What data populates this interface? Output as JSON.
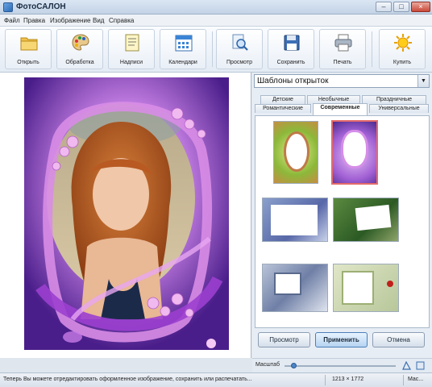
{
  "window": {
    "title": "ФотоСАЛОН",
    "min": "–",
    "max": "□",
    "close": "×"
  },
  "menu": [
    "Файл",
    "Правка",
    "Изображение",
    "Вид",
    "Справка"
  ],
  "toolbar": {
    "open": "Открыть",
    "process": "Обработка",
    "captions": "Надписи",
    "calendars": "Календари",
    "preview": "Просмотр",
    "save": "Сохранить",
    "print": "Печать",
    "buy": "Купить"
  },
  "panel": {
    "select_value": "Шаблоны открыток",
    "tabs_row1": [
      "Детские",
      "Необычные",
      "Праздничные"
    ],
    "tabs_row2": [
      "Романтические",
      "Современные",
      "Универсальные"
    ],
    "active_tab": "Современные",
    "buttons": {
      "preview": "Просмотр",
      "apply": "Применить",
      "cancel": "Отмена"
    }
  },
  "zoom": {
    "label": "Масштаб"
  },
  "status": {
    "text": "Теперь Вы можете отредактировать оформленное изображение, сохранить или распечатать...",
    "size": "1213 × 1772",
    "zoom": "Мас..."
  },
  "colors": {
    "accent": "#4b7fb8",
    "selection": "#e36a6a",
    "photo_bg": "#b66ad9"
  }
}
